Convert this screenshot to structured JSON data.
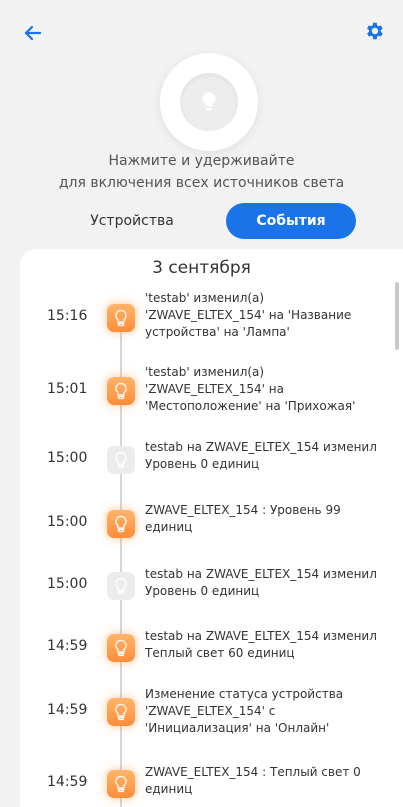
{
  "header": {
    "back_icon": "arrow-left-icon",
    "settings_icon": "gear-icon",
    "accent": "#1a73e8"
  },
  "master_switch": {
    "icon": "lightbulb-icon",
    "hint_line1": "Нажмите и удерживайте",
    "hint_line2": "для включения всех источников света"
  },
  "tabs": {
    "devices": "Устройства",
    "events": "События",
    "active": "events"
  },
  "events_list": {
    "date": "3 сентября",
    "items": [
      {
        "time": "15:16",
        "state": "on",
        "text": "'testab' изменил(а) 'ZWAVE_ELTEX_154' на 'Название устройства' на 'Лампа'"
      },
      {
        "time": "15:01",
        "state": "on",
        "text": "'testab' изменил(а) 'ZWAVE_ELTEX_154' на 'Местоположение' на 'Прихожая'"
      },
      {
        "time": "15:00",
        "state": "off",
        "text": "testab на ZWAVE_ELTEX_154 изменил  Уровень 0 единиц"
      },
      {
        "time": "15:00",
        "state": "on",
        "text": "ZWAVE_ELTEX_154 : Уровень 99 единиц"
      },
      {
        "time": "15:00",
        "state": "off",
        "text": "testab на ZWAVE_ELTEX_154 изменил  Уровень 0 единиц"
      },
      {
        "time": "14:59",
        "state": "on",
        "text": "testab на ZWAVE_ELTEX_154 изменил  Теплый свет 60 единиц"
      },
      {
        "time": "14:59",
        "state": "on",
        "text": "Изменение статуса устройства 'ZWAVE_ELTEX_154' с 'Инициализация' на 'Онлайн'"
      },
      {
        "time": "14:59",
        "state": "on",
        "text": "ZWAVE_ELTEX_154 : Теплый свет 0 единиц"
      }
    ]
  }
}
